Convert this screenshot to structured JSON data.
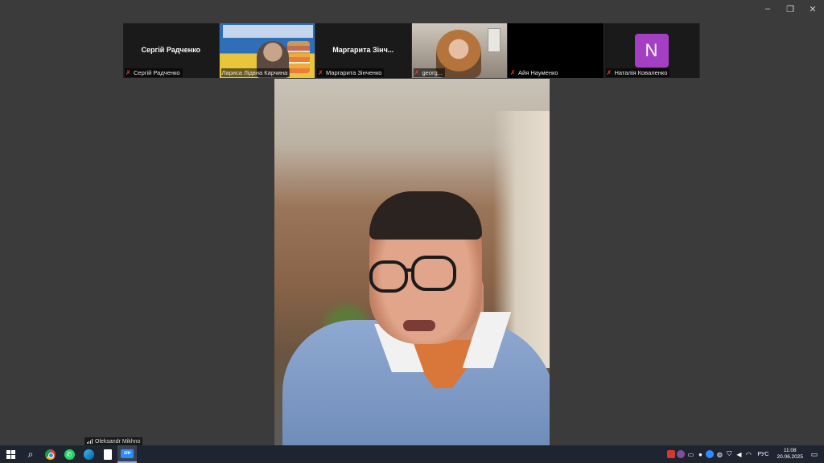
{
  "window": {
    "minimize_icon": "minimize-icon",
    "restore_icon": "restore-icon",
    "close_icon": "close-icon",
    "minimize": "–",
    "restore": "❐",
    "close": "✕"
  },
  "participants": [
    {
      "center_name": "Сергій Радченко",
      "label": "Сергій Радченко",
      "muted": true
    },
    {
      "label": "Лариса Лiдвна Карчина",
      "muted": false
    },
    {
      "center_name": "Маргарита  Зінч...",
      "label": "Маргарита Зінченко",
      "muted": true
    },
    {
      "label": "georg...",
      "muted": true
    },
    {
      "label": "Айя Науменко",
      "muted": true
    },
    {
      "avatar_letter": "N",
      "avatar_color": "#a43fc4",
      "label": "Наталія Коваленко",
      "muted": true
    }
  ],
  "speaker": {
    "name": "Oleksandr Mikhno",
    "signal_icon": "signal-bars-icon"
  },
  "taskbar": {
    "apps": [
      "windows-start-icon",
      "search-icon",
      "chrome-icon",
      "whatsapp-icon",
      "edge-icon",
      "file-icon",
      "zoom-icon"
    ],
    "zoom_label": "zm",
    "whatsapp_glyph": "✆",
    "search_glyph": "⌕",
    "tray_icons": [
      "record-icon",
      "viber-icon",
      "device-icon",
      "mic-icon",
      "zoom-tray-icon",
      "network-icon",
      "shield-icon",
      "speaker-icon",
      "wifi-icon"
    ],
    "language": "РУС",
    "time": "11:08",
    "date": "20.06.2025",
    "notification_glyph": "▭",
    "mic_off_glyph": "✗"
  }
}
